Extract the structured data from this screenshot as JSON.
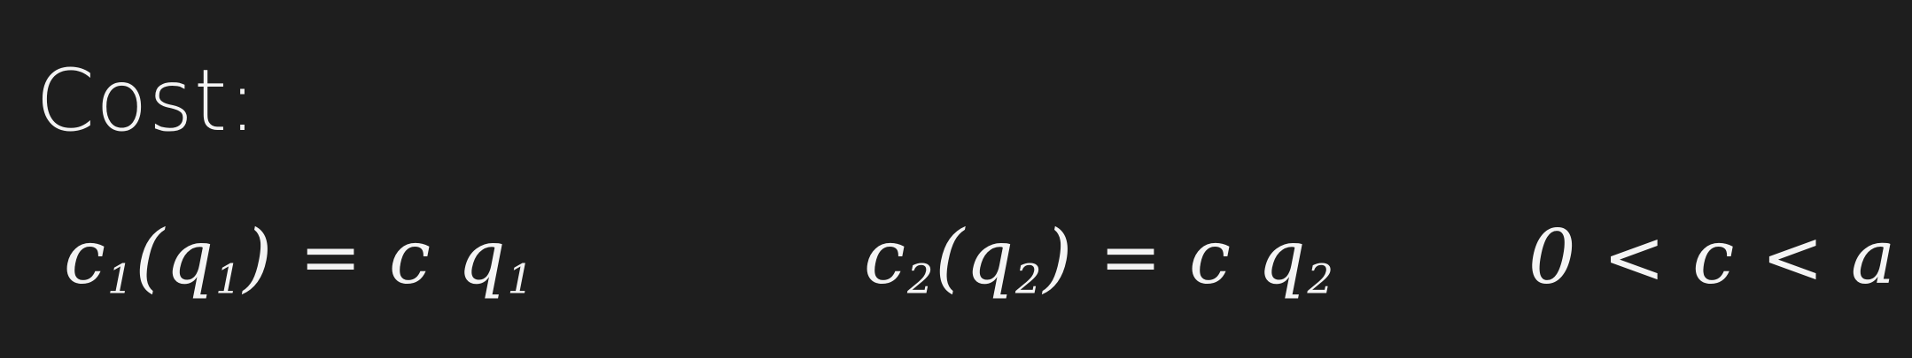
{
  "notes": {
    "title": "Cost:",
    "cost_firm1": {
      "lhs": "c",
      "lhs_sub": "1",
      "arg": "q",
      "arg_sub": "1",
      "rhs": "= c q",
      "rhs_sub": "1"
    },
    "cost_firm2": {
      "lhs": "c",
      "lhs_sub": "2",
      "arg": "q",
      "arg_sub": "2",
      "rhs": "= c q",
      "rhs_sub": "2"
    },
    "condition": "0 < c < a"
  }
}
